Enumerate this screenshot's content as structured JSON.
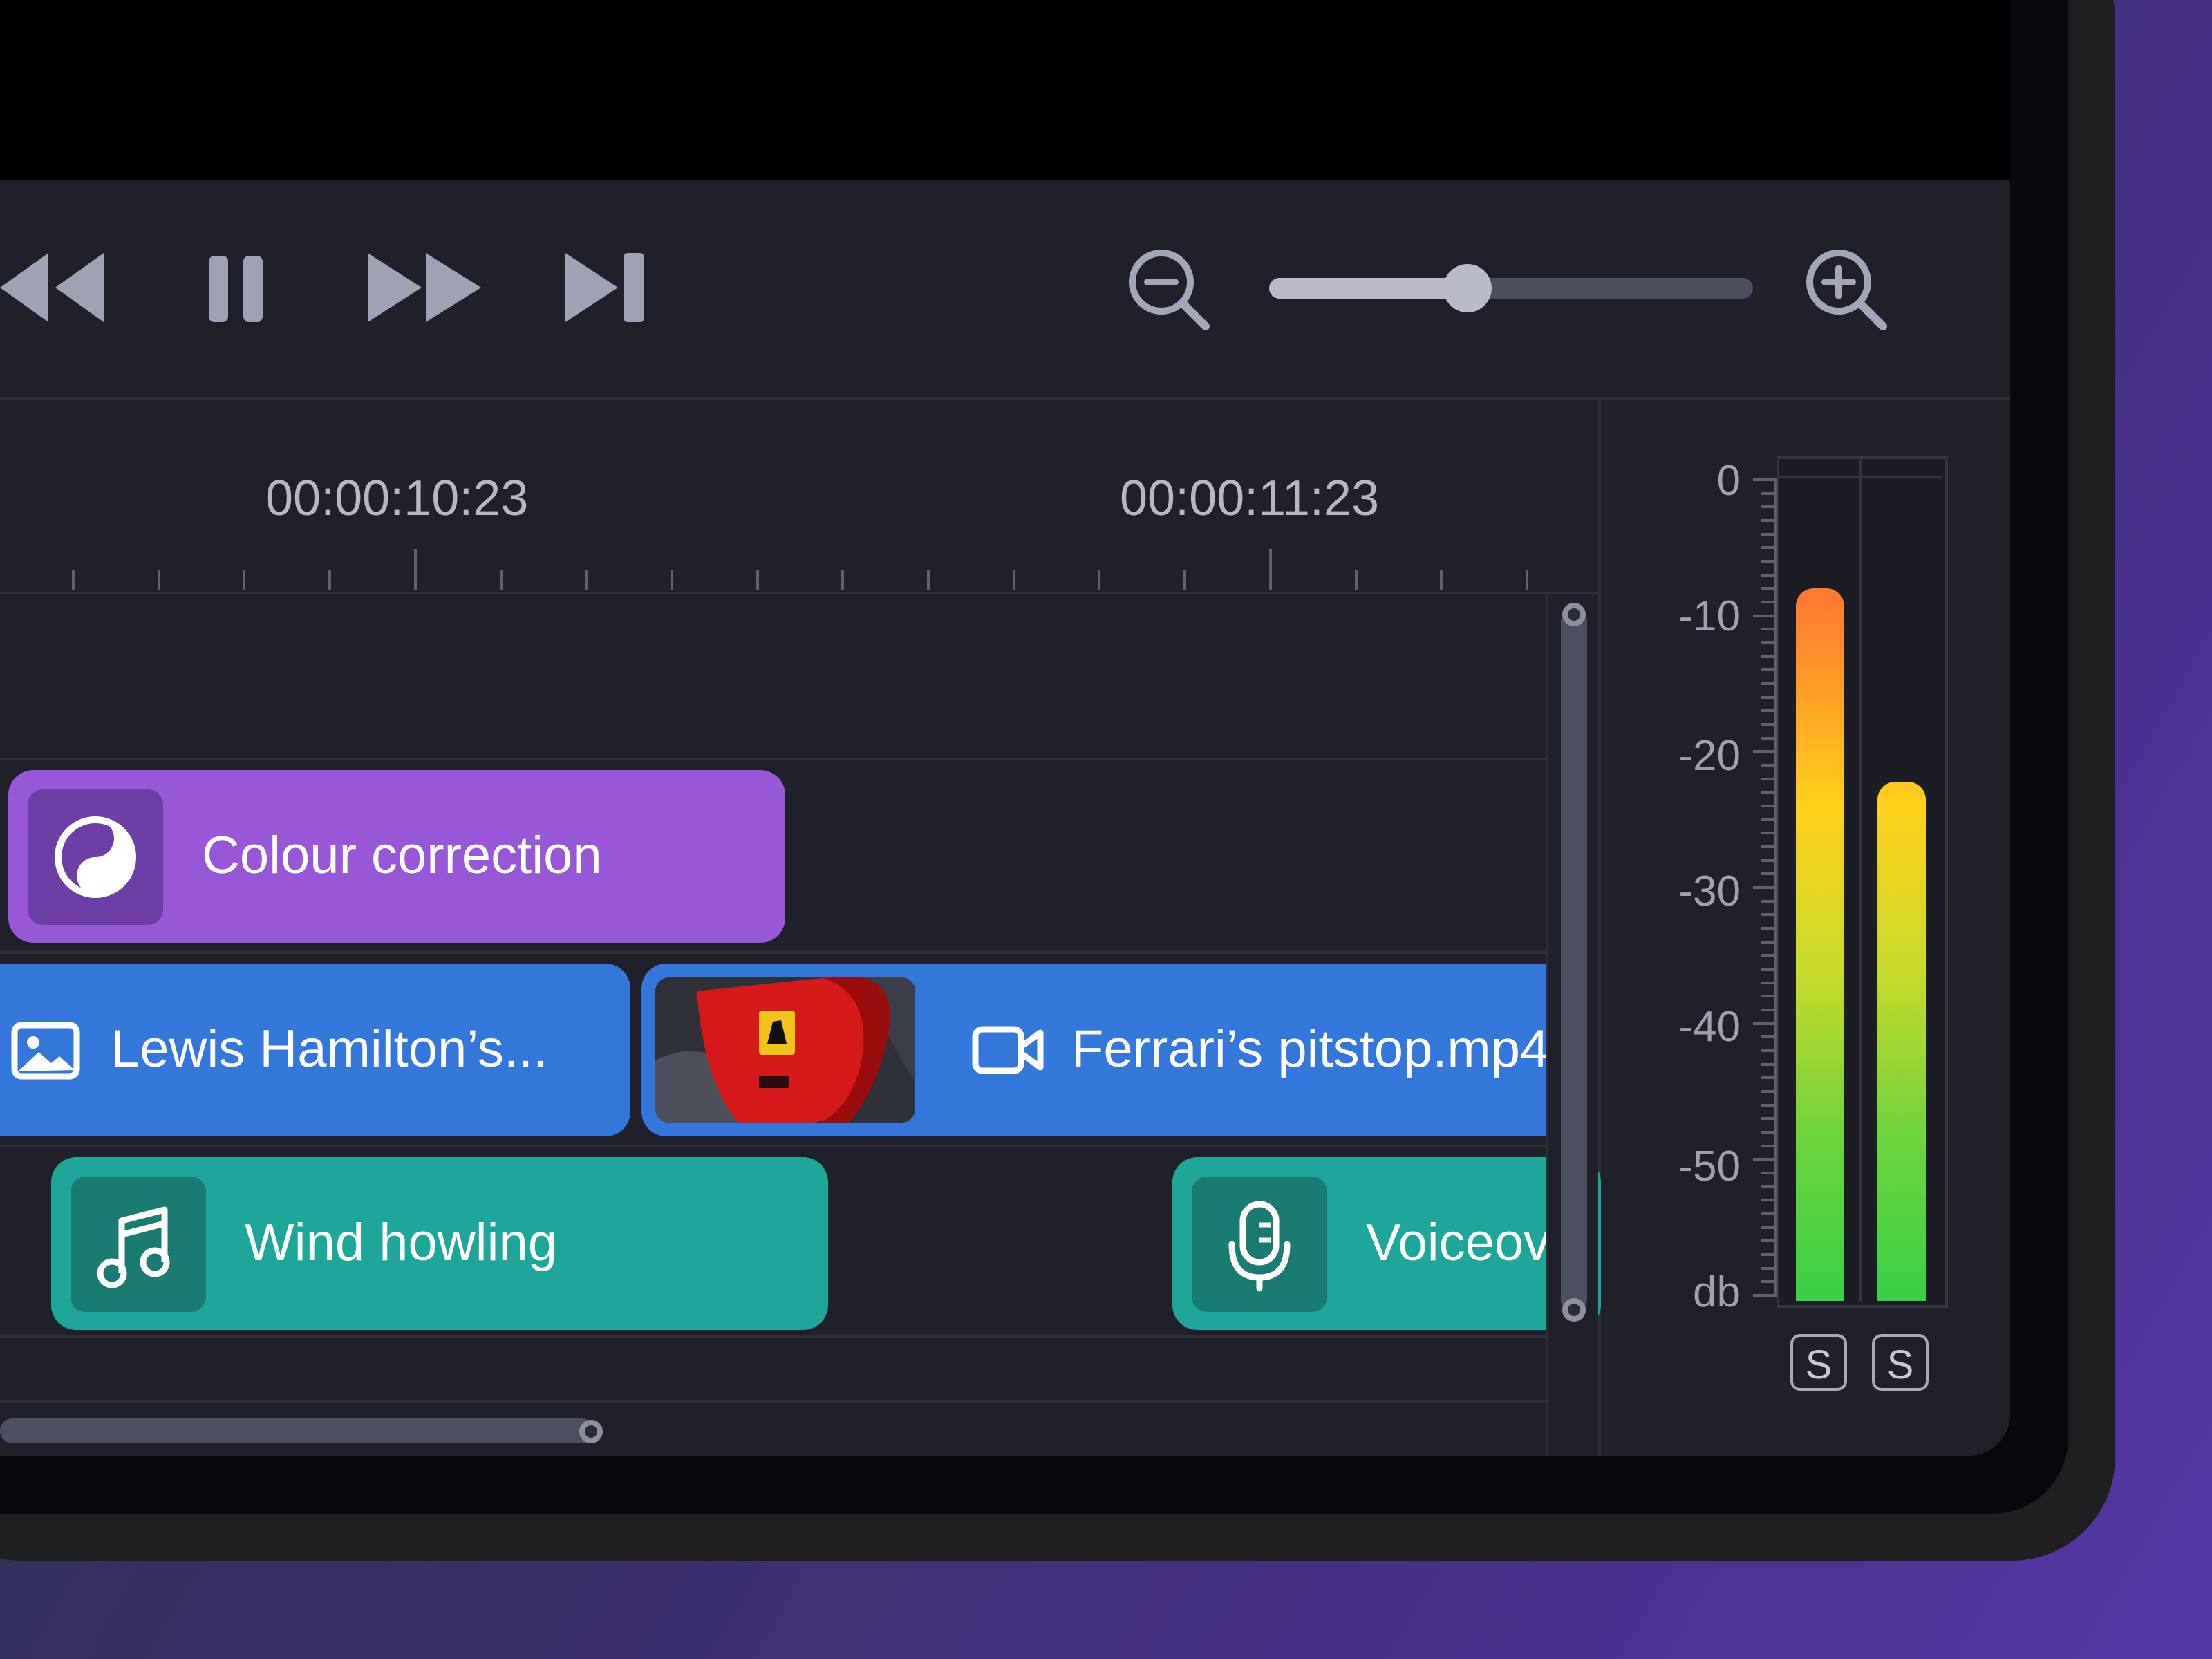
{
  "timeline": {
    "timecodes": [
      "00:00:10:23",
      "00:00:11:23"
    ]
  },
  "zoom": {
    "level": 0.41
  },
  "clips": {
    "colour": {
      "label": "Colour correction",
      "color": "#9757d7",
      "icon": "colour-correction-icon"
    },
    "image": {
      "label": "Lewis Hamilton’s...",
      "color": "#3377db",
      "icon": "image-icon"
    },
    "video": {
      "label": "Ferrari’s pitstop.mp4",
      "color": "#3377db",
      "icon": "video-camera-icon"
    },
    "wind": {
      "label": "Wind howling",
      "color": "#1fa69b",
      "icon": "music-note-icon"
    },
    "voice": {
      "label": "Voiceover",
      "color": "#1fa69b",
      "icon": "microphone-icon"
    }
  },
  "meter": {
    "labels": [
      "0",
      "-10",
      "-20",
      "-30",
      "-40",
      "-50",
      "db"
    ],
    "levels": [
      0.865,
      0.63
    ],
    "solo_label": "S"
  },
  "colors": {
    "accent_blue": "#3377db",
    "accent_purple": "#9757d7",
    "accent_teal": "#1fa69b"
  }
}
